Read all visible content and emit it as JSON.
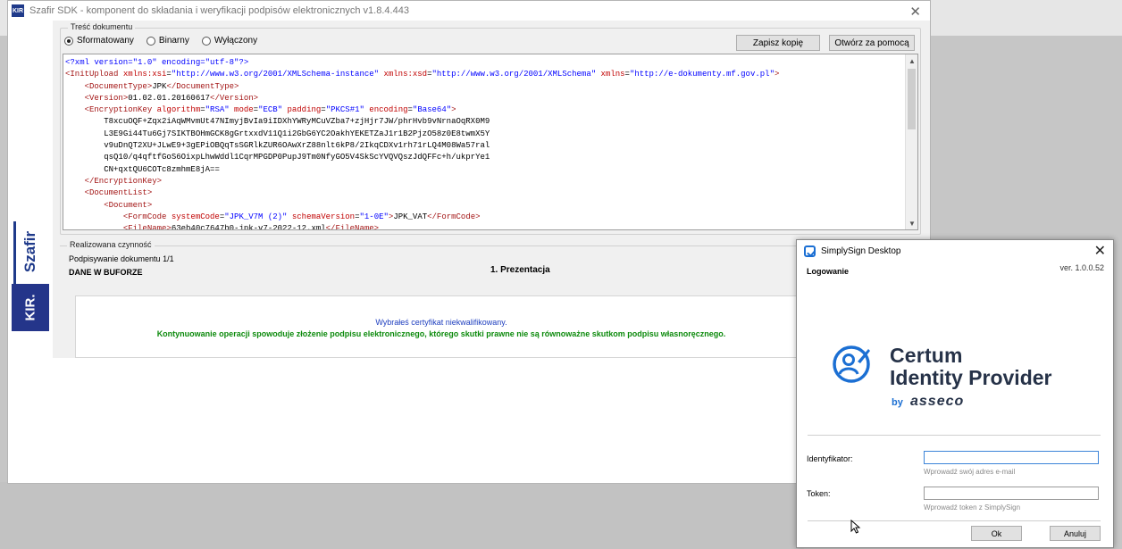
{
  "szafir": {
    "title": "Szafir SDK - komponent do składania i weryfikacji podpisów elektronicznych v1.8.4.443",
    "icon": "kir-app-icon",
    "close_glyph": "✕",
    "logo_szafir": "Szafir",
    "logo_kir": "KIR.",
    "doc_group_label": "Treść dokumentu",
    "radios": {
      "formatted": "Sformatowany",
      "binary": "Binarny",
      "off": "Wyłączony",
      "selected": "formatted"
    },
    "buttons": {
      "save_copy": "Zapisz kopię",
      "open_with": "Otwórz za pomocą"
    },
    "xml_lines": [
      {
        "indent": 0,
        "parts": [
          [
            "pi",
            "<?xml version=\"1.0\" encoding=\"utf-8\"?>"
          ]
        ]
      },
      {
        "indent": 0,
        "parts": [
          [
            "tag",
            "<InitUpload "
          ],
          [
            "att",
            "xmlns:xsi"
          ],
          [
            "txt",
            "="
          ],
          [
            "val",
            "\"http://www.w3.org/2001/XMLSchema-instance\" "
          ],
          [
            "att",
            "xmlns:xsd"
          ],
          [
            "txt",
            "="
          ],
          [
            "val",
            "\"http://www.w3.org/2001/XMLSchema\" "
          ],
          [
            "att",
            "xmlns"
          ],
          [
            "txt",
            "="
          ],
          [
            "val",
            "\"http://e-dokumenty.mf.gov.pl\""
          ],
          [
            "tag",
            ">"
          ]
        ]
      },
      {
        "indent": 1,
        "parts": [
          [
            "tag",
            "<DocumentType>"
          ],
          [
            "txt",
            "JPK"
          ],
          [
            "tag",
            "</DocumentType>"
          ]
        ]
      },
      {
        "indent": 1,
        "parts": [
          [
            "tag",
            "<Version>"
          ],
          [
            "txt",
            "01.02.01.20160617"
          ],
          [
            "tag",
            "</Version>"
          ]
        ]
      },
      {
        "indent": 1,
        "parts": [
          [
            "tag",
            "<EncryptionKey "
          ],
          [
            "att",
            "algorithm"
          ],
          [
            "txt",
            "="
          ],
          [
            "val",
            "\"RSA\" "
          ],
          [
            "att",
            "mode"
          ],
          [
            "txt",
            "="
          ],
          [
            "val",
            "\"ECB\" "
          ],
          [
            "att",
            "padding"
          ],
          [
            "txt",
            "="
          ],
          [
            "val",
            "\"PKCS#1\" "
          ],
          [
            "att",
            "encoding"
          ],
          [
            "txt",
            "="
          ],
          [
            "val",
            "\"Base64\""
          ],
          [
            "tag",
            ">"
          ]
        ]
      },
      {
        "indent": 2,
        "parts": [
          [
            "txt",
            "T8xcuOQF+Zqx2iAqWMvmUt47NImyjBvIa9iIDXhYWRyMCuVZba7+zjHjr7JW/phrHvb9vNrnaOqRX0M9"
          ]
        ]
      },
      {
        "indent": 2,
        "parts": [
          [
            "txt",
            "L3E9Gi44Tu6Gj7SIKTBOHmGCK8gGrtxxdV11Q1i2GbG6YC2OakhYEKETZaJ1r1B2PjzO58z0E8twmX5Y"
          ]
        ]
      },
      {
        "indent": 2,
        "parts": [
          [
            "txt",
            "v9uDnQT2XU+JLwE9+3gEPiOBQqTsSGRlkZUR6OAwXrZ88nlt6kP8/2IkqCDXv1rh71rLQ4M08Wa57ral"
          ]
        ]
      },
      {
        "indent": 2,
        "parts": [
          [
            "txt",
            "qsQ10/q4qftfGoS6OixpLhwWddl1CqrMPGDP0PupJ9Tm0NfyGO5V4SkScYVQVQszJdQFFc+h/ukprYe1"
          ]
        ]
      },
      {
        "indent": 2,
        "parts": [
          [
            "txt",
            "CN+qxtQU6COTc8zmhmE8jA=="
          ]
        ]
      },
      {
        "indent": 1,
        "parts": [
          [
            "tag",
            "</EncryptionKey>"
          ]
        ]
      },
      {
        "indent": 1,
        "parts": [
          [
            "tag",
            "<DocumentList>"
          ]
        ]
      },
      {
        "indent": 2,
        "parts": [
          [
            "tag",
            "<Document>"
          ]
        ]
      },
      {
        "indent": 3,
        "parts": [
          [
            "tag",
            "<FormCode "
          ],
          [
            "att",
            "systemCode"
          ],
          [
            "txt",
            "="
          ],
          [
            "val",
            "\"JPK_V7M (2)\" "
          ],
          [
            "att",
            "schemaVersion"
          ],
          [
            "txt",
            "="
          ],
          [
            "val",
            "\"1-0E\""
          ],
          [
            "tag",
            ">"
          ],
          [
            "txt",
            "JPK_VAT"
          ],
          [
            "tag",
            "</FormCode>"
          ]
        ]
      },
      {
        "indent": 3,
        "parts": [
          [
            "tag",
            "<FileName>"
          ],
          [
            "txt",
            "63eb40c7647b0-jpk-v7-2022-12.xml"
          ],
          [
            "tag",
            "</FileName>"
          ]
        ]
      }
    ],
    "action_group_label": "Realizowana czynność",
    "signing_doc": "Podpisywanie dokumentu 1/1",
    "buffer_label": "DANE W BUFORZE",
    "step_label": "1. Prezentacja",
    "msg_cert": "Wybrałeś certyfikat niekwalifikowany.",
    "msg_warning": "Kontynuowanie operacji spowoduje złożenie podpisu elektronicznego, którego skutki prawne nie są równoważne skutkom podpisu własnoręcznego."
  },
  "simplysign": {
    "title": "SimplySign Desktop",
    "icon": "simplysign-icon",
    "close_glyph": "✕",
    "heading": "Logowanie",
    "version": "ver. 1.0.0.52",
    "logo_line1": "Certum",
    "logo_line2": "Identity Provider",
    "logo_by": "by",
    "logo_brand": "asseco",
    "id_label": "Identyfikator:",
    "id_value": "",
    "id_hint": "Wprowadź swój adres e-mail",
    "token_label": "Token:",
    "token_value": "",
    "token_hint": "Wprowadź token z SimplySign",
    "ok_label": "Ok",
    "cancel_label": "Anuluj",
    "colors": {
      "brand_blue": "#1b6fd3",
      "brand_dark": "#263248"
    }
  }
}
